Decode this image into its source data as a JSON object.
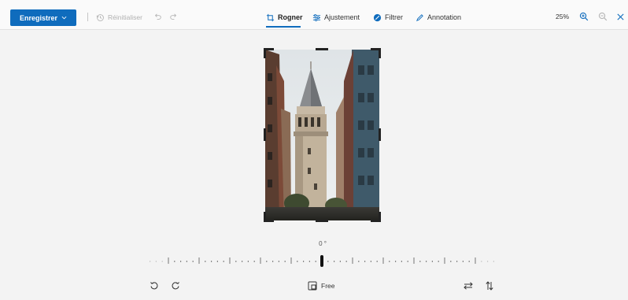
{
  "toolbar": {
    "save_label": "Enregistrer",
    "reset_label": "Réinitialiser",
    "tabs": [
      {
        "label": "Rogner",
        "icon": "crop-icon",
        "active": true
      },
      {
        "label": "Ajustement",
        "icon": "adjust-sliders-icon",
        "active": false
      },
      {
        "label": "Filtrer",
        "icon": "filter-icon",
        "active": false
      },
      {
        "label": "Annotation",
        "icon": "pen-icon",
        "active": false
      }
    ],
    "zoom_level": "25%"
  },
  "crop": {
    "angle": "0 °",
    "aspect_ratio": "Free"
  },
  "colors": {
    "accent": "#0f6cbd",
    "background": "#f3f3f3",
    "toolbar_bg": "#fafafa"
  }
}
